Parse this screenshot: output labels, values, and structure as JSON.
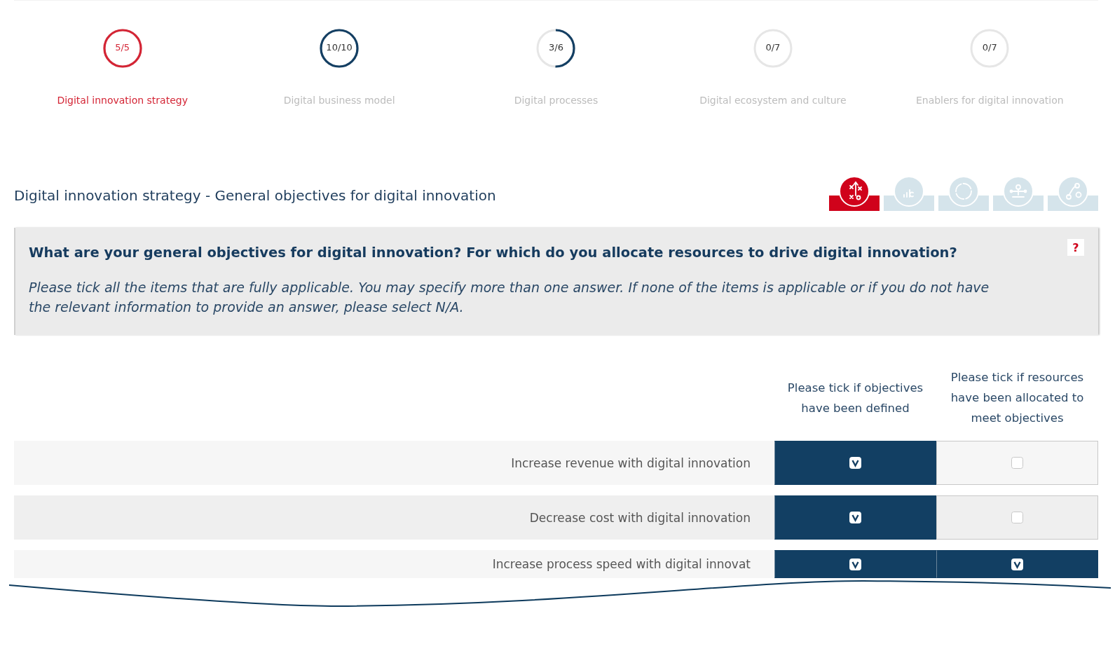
{
  "steps": [
    {
      "count": "5/5",
      "label": "Digital innovation strategy",
      "selected": true,
      "level": 1
    },
    {
      "count": "10/10",
      "label": "Digital business model",
      "selected": false,
      "level": 1
    },
    {
      "count": "3/6",
      "label": "Digital processes",
      "selected": false,
      "level": 0.5
    },
    {
      "count": "0/7",
      "label": "Digital ecosystem and culture",
      "selected": false,
      "level": 0
    },
    {
      "count": "0/7",
      "label": "Enablers for digital innovation",
      "selected": false,
      "level": 0
    }
  ],
  "section_title": "Digital innovation strategy - General objectives for digital innovation",
  "category_tabs": [
    {
      "kind": "strategy",
      "selected": true
    },
    {
      "kind": "chart",
      "selected": false
    },
    {
      "kind": "cycle",
      "selected": false
    },
    {
      "kind": "network",
      "selected": false
    },
    {
      "kind": "gears",
      "selected": false
    }
  ],
  "question": {
    "title": "What are your general objectives for digital innovation? For which do you allocate resources to drive digital innovation?",
    "help": "?",
    "instructions": "Please tick all the items that are fully applicable. You may specify more than one answer. If none of the items is applicable or if you do not have the relevant information to provide an answer, please select N/A."
  },
  "table": {
    "columns": [
      "Please tick if objectives have been defined",
      "Please tick if resources have been allocated to meet objectives"
    ],
    "rows": [
      {
        "label": "Increase revenue with digital innovation",
        "cells": [
          {
            "checked": true
          },
          {
            "checked": false
          }
        ]
      },
      {
        "label": "Decrease cost with digital innovation",
        "cells": [
          {
            "checked": true
          },
          {
            "checked": false
          }
        ]
      },
      {
        "label": "Increase process speed with digital innovat",
        "cells": [
          {
            "checked": true
          },
          {
            "checked": true
          }
        ]
      }
    ]
  }
}
